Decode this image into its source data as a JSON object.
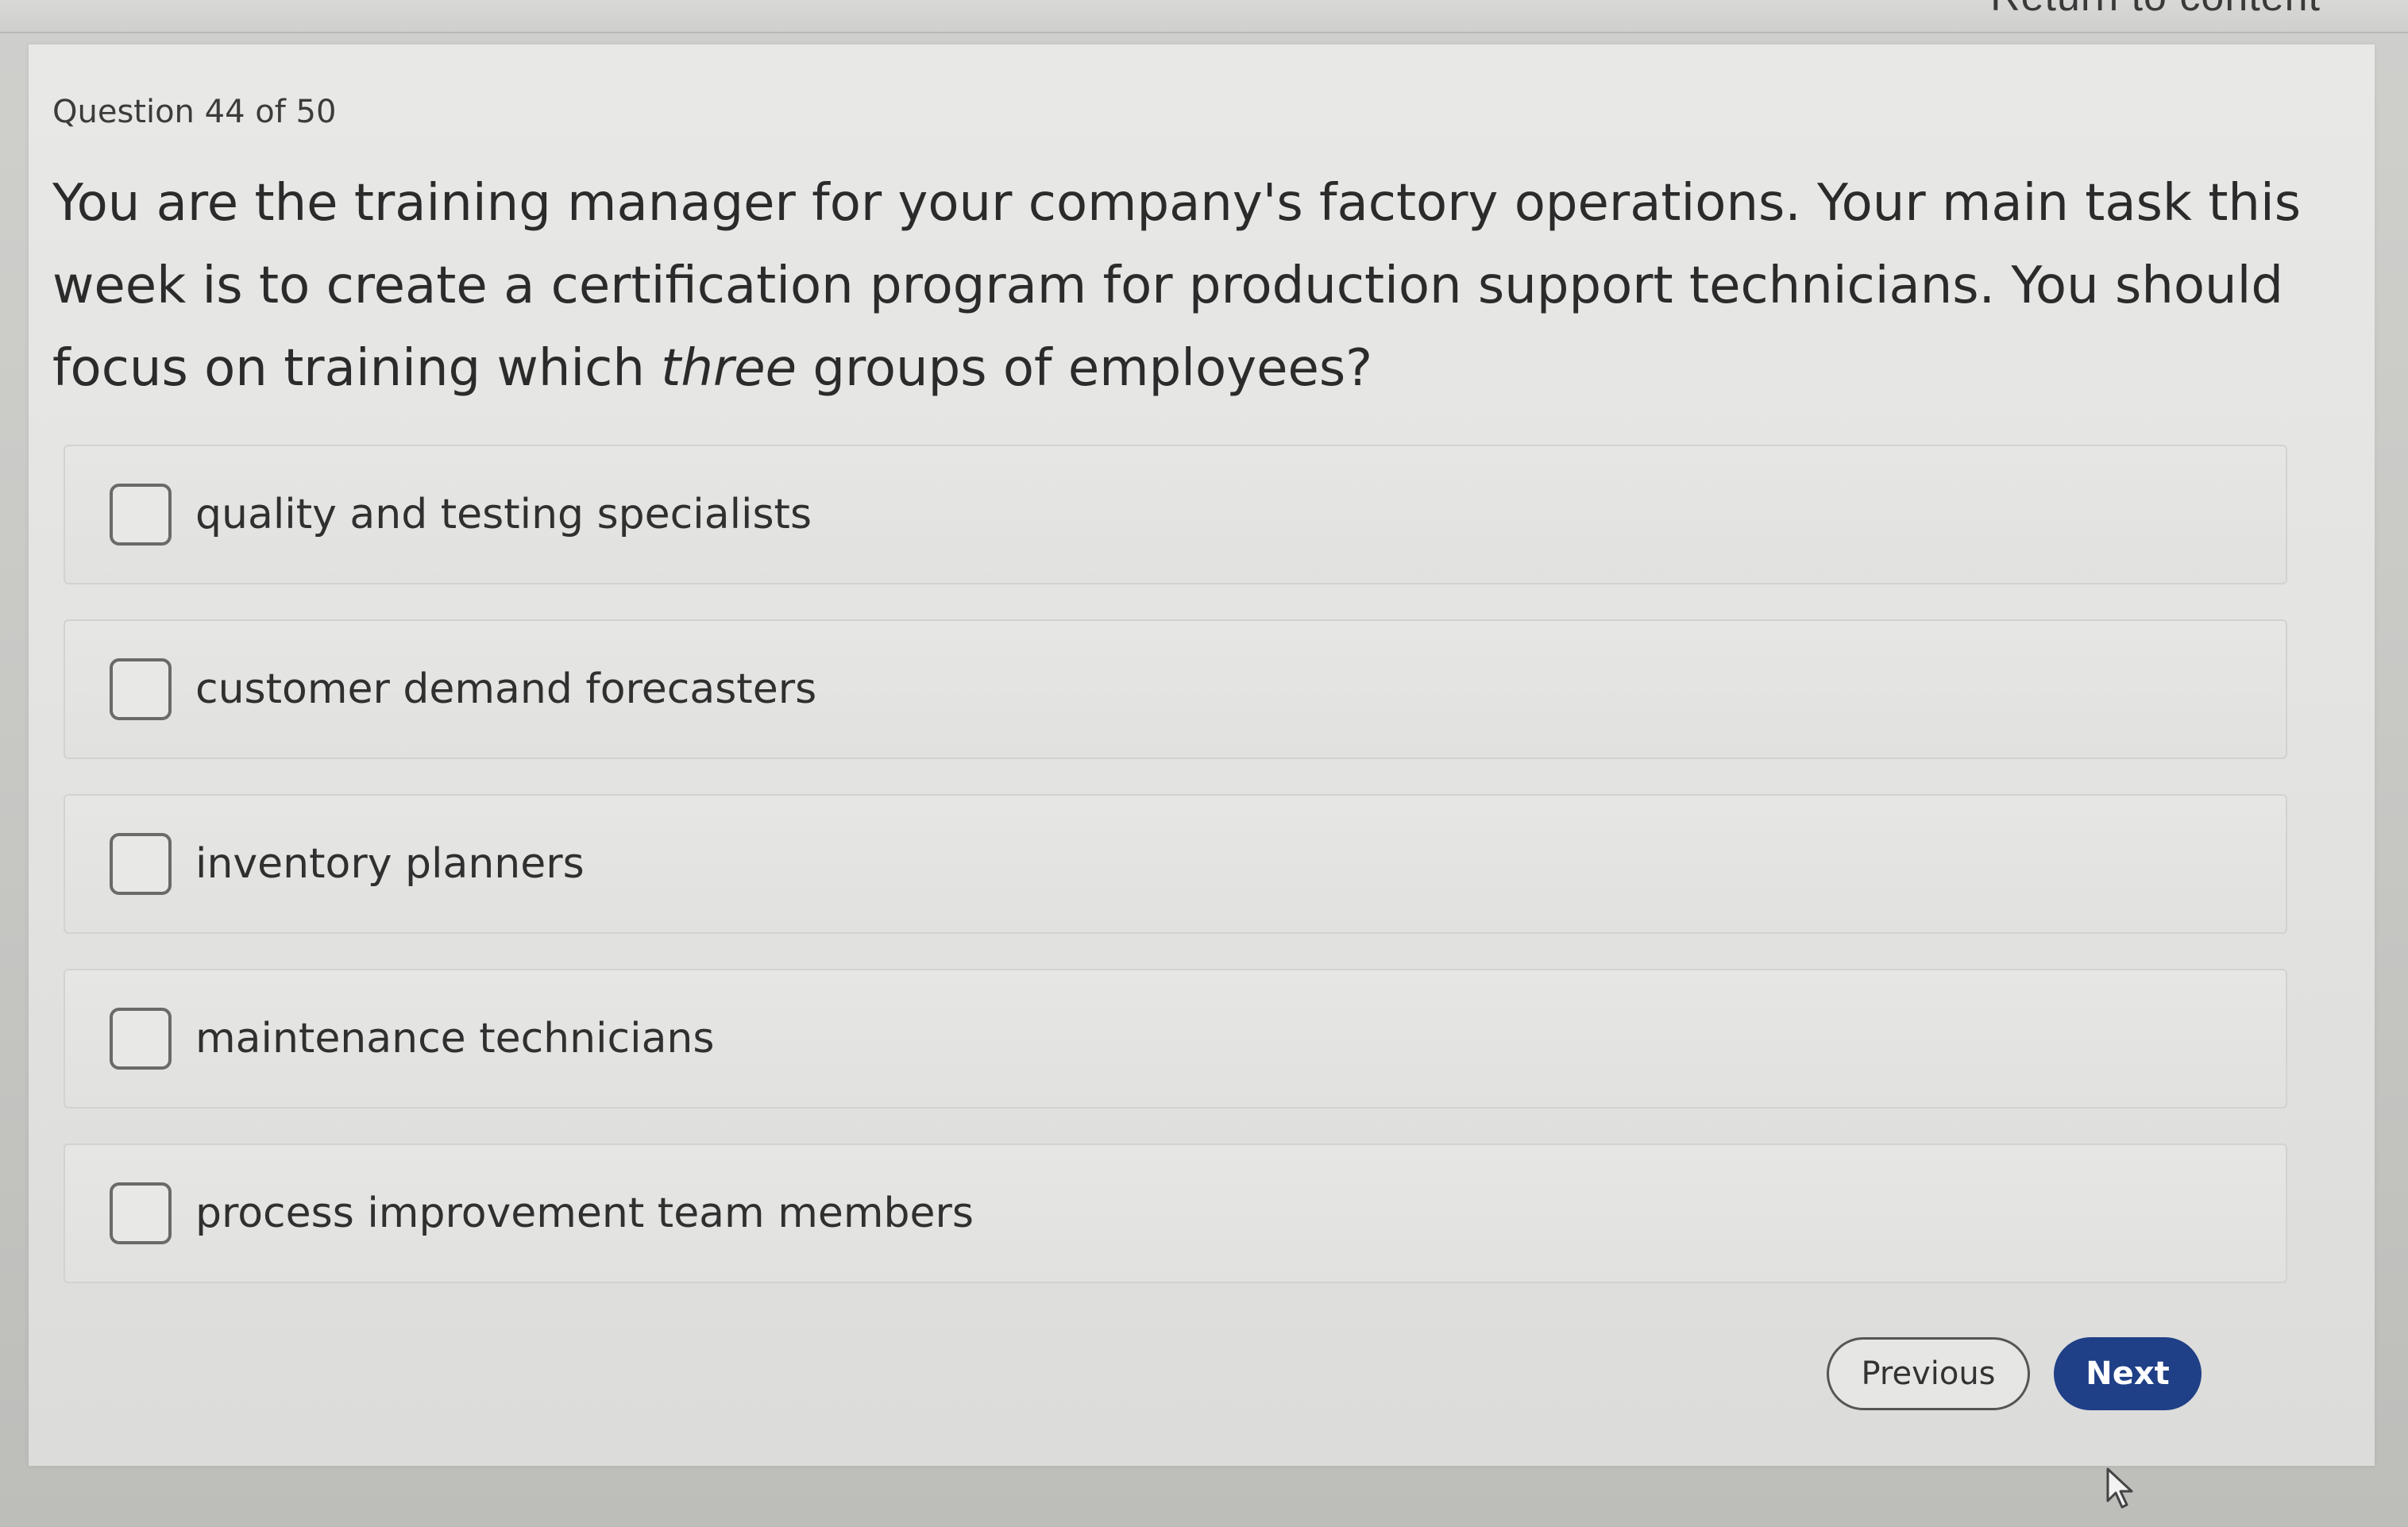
{
  "header": {
    "return_link": "Return to content"
  },
  "question": {
    "counter": "Question 44 of 50",
    "text_before": "You are the training manager for your company's factory operations. Your main task this week is to create a certification program for production support technicians. You should focus on training which ",
    "text_emphasis": "three",
    "text_after": " groups of employees?"
  },
  "options": [
    {
      "label": "quality and testing specialists",
      "checked": false
    },
    {
      "label": "customer demand forecasters",
      "checked": false
    },
    {
      "label": "inventory planners",
      "checked": false
    },
    {
      "label": "maintenance technicians",
      "checked": false
    },
    {
      "label": "process improvement team members",
      "checked": false
    }
  ],
  "nav": {
    "previous_label": "Previous",
    "next_label": "Next"
  },
  "colors": {
    "next_button": "#1f3f86",
    "page_background": "#e6e6e4"
  },
  "icons": {
    "cursor": "mouse-pointer-icon"
  }
}
